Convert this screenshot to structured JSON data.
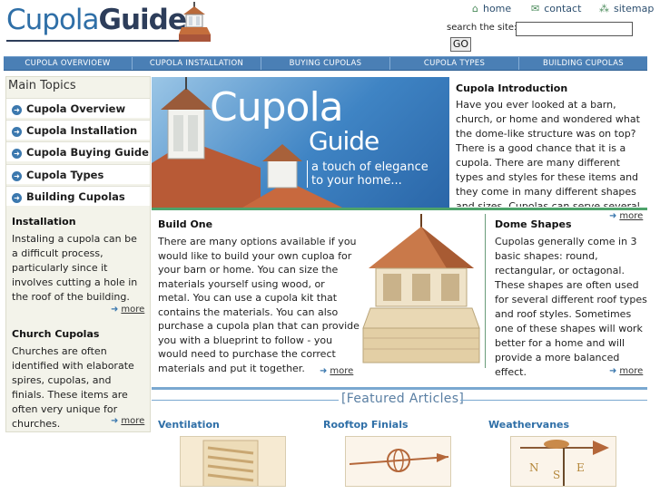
{
  "header": {
    "logo_part1": "Cupola",
    "logo_part2": "Guide",
    "links": {
      "home": "home",
      "contact": "contact",
      "sitemap": "sitemap"
    },
    "search_label": "search the site:",
    "search_placeholder": "",
    "go_label": "GO"
  },
  "nav": [
    "CUPOLA OVERVIOEW",
    "CUPOLA INSTALLATION",
    "BUYING CUPOLAS",
    "CUPOLA TYPES",
    "BUILDING CUPOLAS"
  ],
  "sidebar": {
    "title": "Main Topics",
    "topics": [
      "Cupola Overview",
      "Cupola Installation",
      "Cupola Buying Guide",
      "Cupola Types",
      "Building Cupolas"
    ],
    "installation": {
      "heading": "Installation",
      "text": "Instaling a cupola can be a difficult process, particularly since it involves cutting a hole in the roof of the building.",
      "more": "more"
    },
    "church": {
      "heading": "Church Cupolas",
      "text": "Churches are often identified with elaborate spires, cupolas, and finials. These items are often very unique for churches.",
      "more": "more"
    }
  },
  "hero": {
    "title": "Cupola",
    "subtitle": "Guide",
    "tagline_1": "a touch of elegance",
    "tagline_2": "to your home..."
  },
  "intro": {
    "heading": "Cupola Introduction",
    "text": "Have you ever looked at a barn, church, or home and wondered what the dome-like structure was on top? There is a good chance that it is a cupola. There are many different types and styles for these items and they come in many different shapes and sizes. Cupolas can serve several purposes.",
    "more": "more"
  },
  "build": {
    "heading": "Build One",
    "text": "There are many options available if you would like to build your own cuploa for your barn or home. You can size the materials yourself using wood, or metal. You can use a cupola kit that contains the materials. You can also purchase a cupola plan that can provide you with a blueprint to follow - you would need to purchase the correct materials and put it together.",
    "more": "more"
  },
  "dome": {
    "heading": "Dome Shapes",
    "text": "Cupolas generally come in 3 basic shapes: round, rectangular, or octagonal. These shapes are often used for several different roof types and roof styles. Sometimes one of these shapes will work better for a home and will provide a more balanced effect.",
    "more": "more"
  },
  "featured": {
    "title": "Featured Articles",
    "items": [
      "Ventilation",
      "Rooftop Finials",
      "Weathervanes"
    ]
  },
  "colors": {
    "nav": "#4a7fb5",
    "accent_green": "#4ea36b",
    "link_blue": "#2f6fa7"
  }
}
